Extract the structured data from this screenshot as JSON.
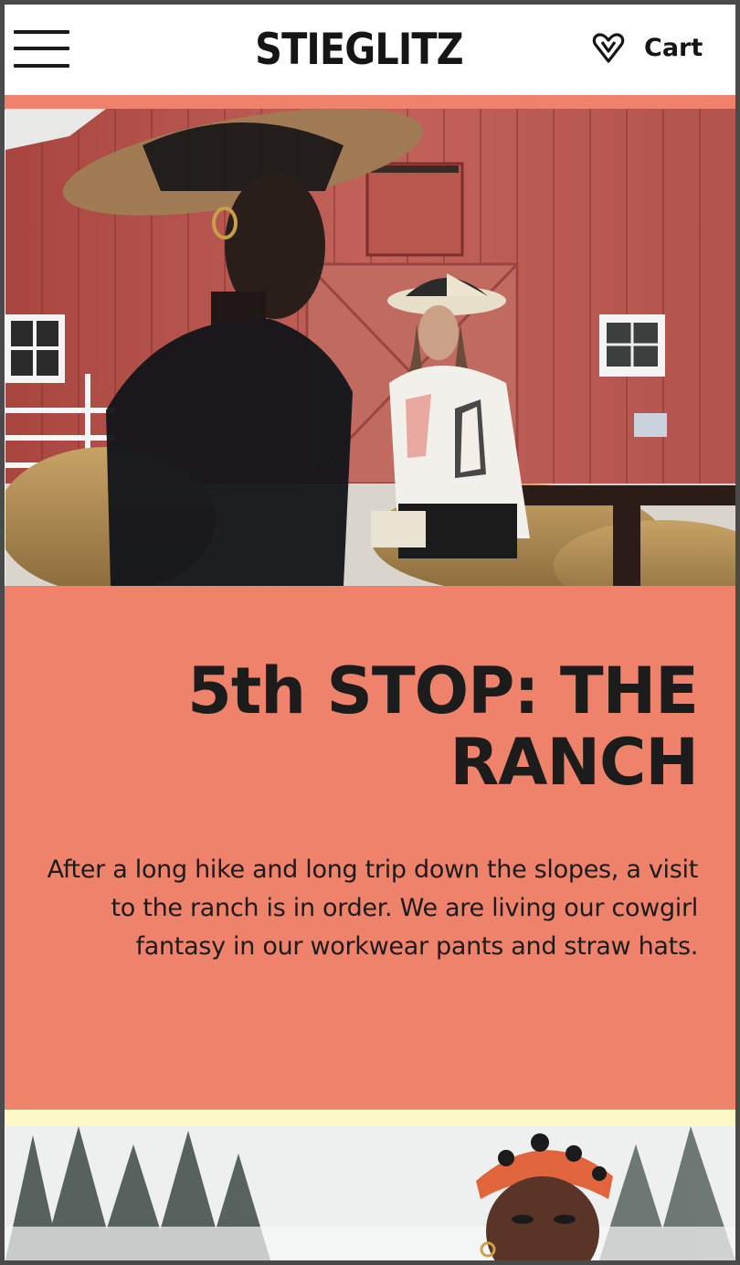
{
  "header": {
    "brand": "STIEGLITZ",
    "menu_icon": "hamburger-menu-icon",
    "wishlist_icon": "heart-icon",
    "cart_label": "Cart"
  },
  "colors": {
    "accent": "#ee826b",
    "cream": "#fdf8c8",
    "text": "#1c1c1c"
  },
  "story": {
    "title": "5th STOP: THE RANCH",
    "body": "After a long hike and long trip down the slopes, a visit to the ranch is in order. We are living our cowgirl fantasy in our workwear pants and straw hats."
  }
}
